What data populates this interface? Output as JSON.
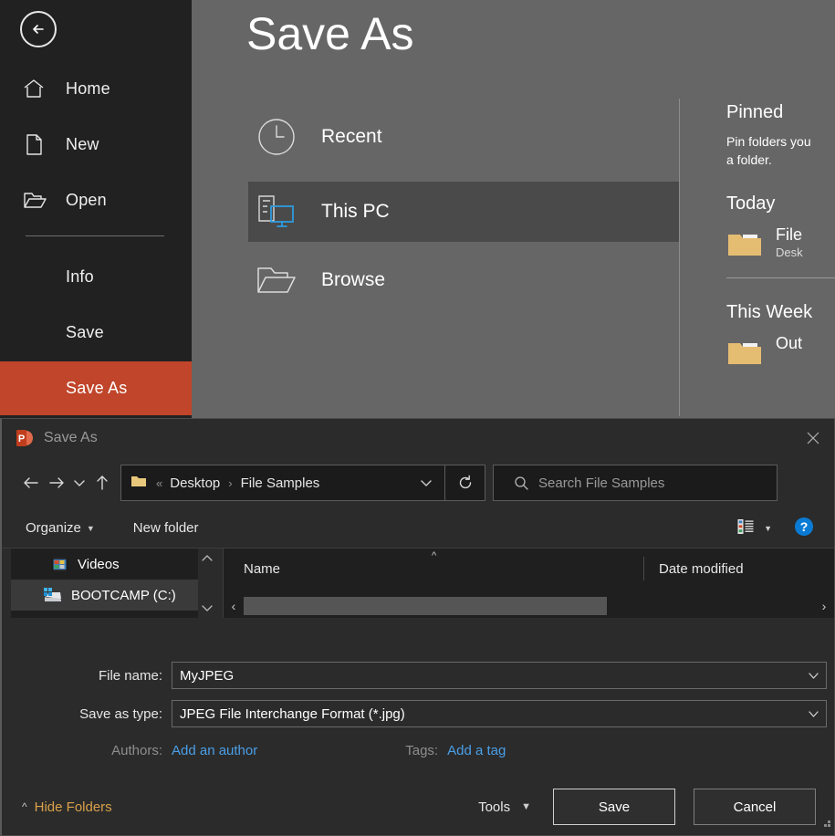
{
  "backstage": {
    "back_button": "back-arrow",
    "title": "Save As",
    "nav_items": [
      {
        "label": "Home",
        "icon": "home-icon"
      },
      {
        "label": "New",
        "icon": "new-document-icon"
      },
      {
        "label": "Open",
        "icon": "open-folder-icon"
      },
      {
        "label": "Info",
        "icon": ""
      },
      {
        "label": "Save",
        "icon": ""
      },
      {
        "label": "Save As",
        "icon": ""
      }
    ],
    "active_nav": "Save As",
    "accent_color": "#c0452a",
    "places": [
      {
        "label": "Recent",
        "icon": "clock-icon",
        "selected": false
      },
      {
        "label": "This PC",
        "icon": "this-pc-icon",
        "selected": true
      },
      {
        "label": "Browse",
        "icon": "folder-open-icon",
        "selected": false
      }
    ],
    "pinned": {
      "heading": "Pinned",
      "description": "Pin folders you\na folder.",
      "today_heading": "Today",
      "today_item_name": "File",
      "today_item_path": "Desk",
      "week_heading": "This Week",
      "week_item_name": "Out"
    }
  },
  "dialog": {
    "title": "Save As",
    "app_icon": "powerpoint-icon",
    "close_icon": "close-icon",
    "nav": {
      "back_icon": "arrow-left-icon",
      "forward_icon": "arrow-right-icon",
      "recent_icon": "chevron-down-icon",
      "up_icon": "arrow-up-icon"
    },
    "address": {
      "folder_icon": "folder-icon",
      "overflow": "«",
      "crumbs": [
        "Desktop",
        "File Samples"
      ],
      "separator": "›",
      "dropdown_icon": "chevron-down-icon",
      "refresh_icon": "refresh-icon"
    },
    "search": {
      "icon": "search-icon",
      "placeholder": "Search File Samples",
      "value": ""
    },
    "toolbar": {
      "organize": "Organize",
      "new_folder": "New folder",
      "view_icon": "view-details-icon",
      "view_caret": "▼",
      "help_icon": "help-icon"
    },
    "nav_tree": [
      {
        "label": "Videos",
        "icon": "videos-icon",
        "selected": false
      },
      {
        "label": "BOOTCAMP (C:)",
        "icon": "drive-icon",
        "selected": true
      }
    ],
    "columns": [
      {
        "label": "Name",
        "sorted": true,
        "sort_arrow": "^"
      },
      {
        "label": "Date modified",
        "sorted": false,
        "sort_arrow": ""
      }
    ],
    "fields": [
      {
        "label": "File name:",
        "value": "MyJPEG",
        "caret": "chevron-down-icon"
      },
      {
        "label": "Save as type:",
        "value": "JPEG File Interchange Format (*.jpg)",
        "caret": "chevron-down-icon"
      }
    ],
    "metadata": {
      "authors_label": "Authors:",
      "authors_link": "Add an author",
      "tags_label": "Tags:",
      "tags_link": "Add a tag",
      "link_color": "#4a9fe8"
    },
    "footer": {
      "hide_folders": "Hide Folders",
      "hide_folders_caret": "^",
      "tools": "Tools",
      "tools_caret": "▼",
      "save_button": "Save",
      "cancel_button": "Cancel"
    }
  }
}
